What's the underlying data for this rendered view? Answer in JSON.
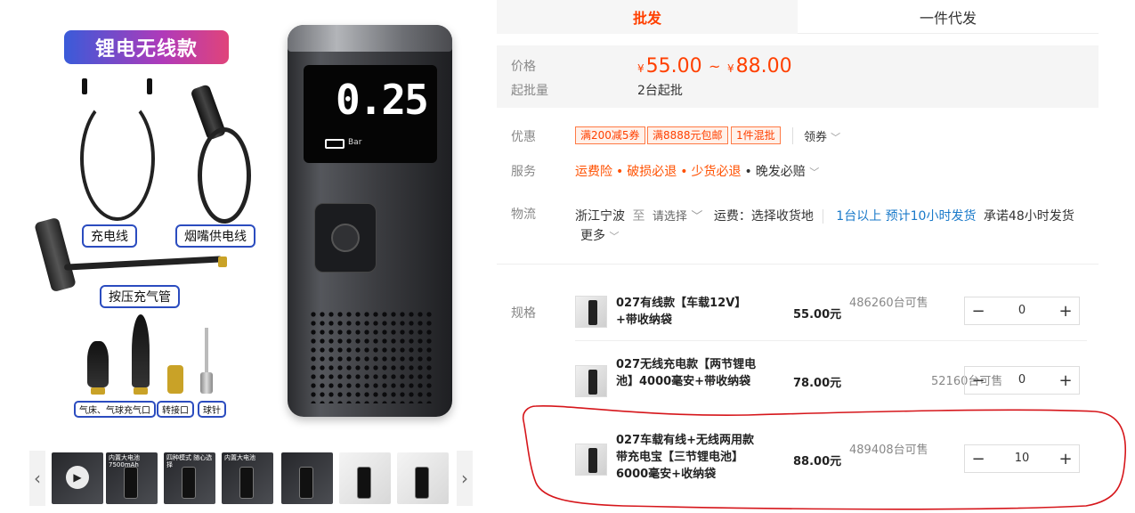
{
  "gallery": {
    "badge": "锂电无线款",
    "labels": {
      "charge_cable": "充电线",
      "cig_cable": "烟嘴供电线",
      "press_hose": "按压充气管",
      "nozzle_1": "气床、气球充气口",
      "nozzle_2": "转接口",
      "nozzle_3": "球针"
    },
    "device": {
      "display_value": "0.25",
      "unit": "Bar"
    },
    "thumbnails": [
      {
        "text": "",
        "type": "video"
      },
      {
        "text": "内置大电池 7500mAh",
        "type": "dark"
      },
      {
        "text": "四种模式 随心选择",
        "type": "dark"
      },
      {
        "text": "内置大电池",
        "type": "dark"
      },
      {
        "text": "",
        "type": "dark"
      },
      {
        "text": "",
        "type": "light"
      },
      {
        "text": "",
        "type": "light"
      }
    ]
  },
  "tabs": [
    {
      "label": "批发",
      "active": true
    },
    {
      "label": "一件代发",
      "active": false
    }
  ],
  "price": {
    "label": "价格",
    "currency": "¥",
    "min": "55.00",
    "max": "88.00",
    "tilde": "~",
    "moq_label": "起批量",
    "moq_value": "2台起批"
  },
  "promo": {
    "label": "优惠",
    "coupons": [
      "满200减5券",
      "满8888元包邮",
      "1件混批"
    ],
    "more": "领券"
  },
  "service": {
    "label": "服务",
    "items": [
      "运费险",
      "破损必退",
      "少货必退"
    ],
    "extra": "晚发必赔"
  },
  "logistics": {
    "label": "物流",
    "origin": "浙江宁波",
    "to": "至",
    "select": "请选择",
    "fee": "运费：选择收货地",
    "eta": "1台以上 预计10小时发货",
    "promise": "承诺48小时发货",
    "more": "更多"
  },
  "specs": {
    "label": "规格",
    "items": [
      {
        "name": "027有线款【车载12V】+带收纳袋",
        "price": "55.00元",
        "stock": "486260台可售",
        "qty": "0"
      },
      {
        "name": "027无线充电款【两节锂电池】4000毫安+带收纳袋",
        "price": "78.00元",
        "stock": "52160台可售",
        "qty": "0"
      },
      {
        "name": "027车载有线+无线两用款带充电宝【三节锂电池】6000毫安+收纳袋",
        "price": "88.00元",
        "stock": "489408台可售",
        "qty": "10"
      }
    ]
  },
  "colors": {
    "accent": "#ff4000",
    "highlight": "#d6161b",
    "link": "#1979c9"
  }
}
